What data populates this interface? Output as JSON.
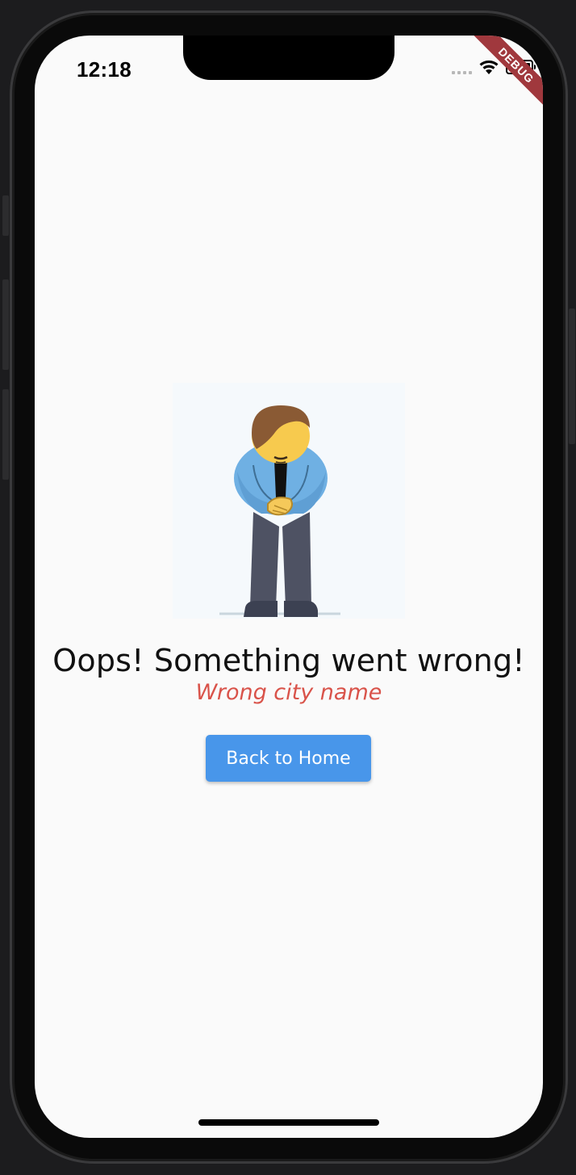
{
  "status_bar": {
    "time": "12:18",
    "signal_icon": "signal-dots-icon",
    "wifi_icon": "wifi-icon",
    "battery_icon": "battery-icon"
  },
  "debug_banner": {
    "label": "DEBUG",
    "color": "#a0383d"
  },
  "error": {
    "illustration": "bowing-man-apology-illustration",
    "title": "Oops! Something went wrong!",
    "message": "Wrong city name",
    "message_color": "#d9534a"
  },
  "actions": {
    "back_home_label": "Back to Home",
    "button_color": "#4896ea"
  }
}
